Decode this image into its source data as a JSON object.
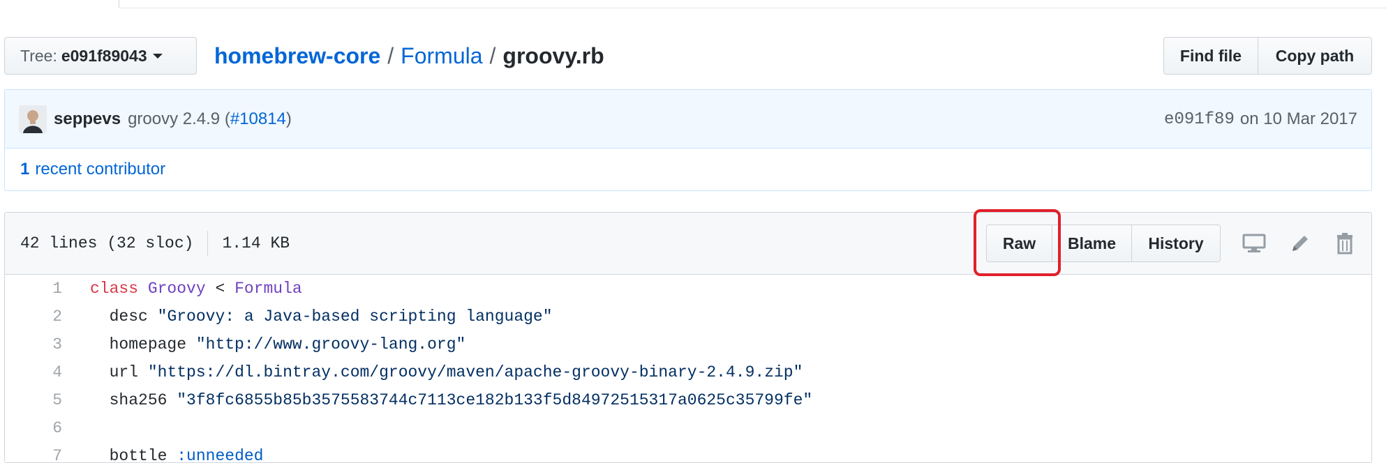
{
  "tree": {
    "label": "Tree:",
    "value": "e091f89043"
  },
  "breadcrumb": {
    "repo": "homebrew-core",
    "sep1": "/",
    "folder": "Formula",
    "sep2": "/",
    "file": "groovy.rb"
  },
  "actions": {
    "find_file": "Find file",
    "copy_path": "Copy path"
  },
  "commit": {
    "author": "seppevs",
    "message_prefix": "groovy 2.4.9 (",
    "pr_link": "#10814",
    "message_suffix": ")",
    "sha": "e091f89",
    "date": "on 10 Mar 2017"
  },
  "contributors": {
    "count": "1",
    "label": "recent contributor"
  },
  "file_info": {
    "lines": "42 lines (32 sloc)",
    "size": "1.14 KB"
  },
  "file_actions": {
    "raw": "Raw",
    "blame": "Blame",
    "history": "History"
  },
  "code": {
    "lines": [
      {
        "n": "1",
        "kw": "class",
        "cls1": "Groovy",
        "op": "<",
        "cls2": "Formula"
      },
      {
        "n": "2",
        "key": "desc",
        "str": "\"Groovy: a Java-based scripting language\""
      },
      {
        "n": "3",
        "key": "homepage",
        "str": "\"http://www.groovy-lang.org\""
      },
      {
        "n": "4",
        "key": "url",
        "str": "\"https://dl.bintray.com/groovy/maven/apache-groovy-binary-2.4.9.zip\""
      },
      {
        "n": "5",
        "key": "sha256",
        "str": "\"3f8fc6855b85b3575583744c7113ce182b133f5d84972515317a0625c35799fe\""
      },
      {
        "n": "6"
      },
      {
        "n": "7",
        "key": "bottle",
        "sym": ":unneeded"
      }
    ]
  },
  "colors": {
    "accent": "#0366d6",
    "highlight": "#e0202a"
  },
  "icons": [
    "caret-down-icon",
    "avatar",
    "desktop-icon",
    "pencil-icon",
    "trash-icon"
  ]
}
